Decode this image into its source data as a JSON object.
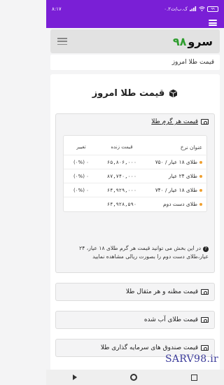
{
  "status_bar": {
    "time": "۸:۱۷",
    "network_info": "۰.۲ک.ب/ث",
    "battery": "۹۹"
  },
  "header": {
    "logo_text": "سرو",
    "logo_number": "۹۸"
  },
  "breadcrumb": {
    "text": "قیمت طلا امروز"
  },
  "page": {
    "title": "قیمت طلا امروز"
  },
  "gold_panel": {
    "title": "قیمت هر گرم طلا",
    "table": {
      "headers": {
        "name": "عنوان نرخ",
        "price": "قیمت زنده",
        "change": "تغییر"
      },
      "rows": [
        {
          "name": "طلای ۱۸ عیار / ۷۵۰",
          "price": "۶۵,۸۰۶,۰۰۰",
          "change": "۰ (۰%)"
        },
        {
          "name": "طلای ۲۴ عیار",
          "price": "۸۷,۷۴۰,۰۰۰",
          "change": "۰ (۰%)"
        },
        {
          "name": "طلای ۱۸ عیار / ۷۴۰",
          "price": "۶۴,۹۲۹,۰۰۰",
          "change": "۰ (۰%)"
        },
        {
          "name": "طلای دست دوم",
          "price": "۶۴,۹۲۸,۵۹۰",
          "change": ""
        }
      ]
    },
    "note": "در این بخش می توانید قیمت هر گرم طلای ۱۸ عیار، ۲۴ عیار،طلای دست دوم را بصورت ریالی مشاهده نمایید"
  },
  "panels": [
    {
      "title": "قیمت مظنه و هر مثقال طلا"
    },
    {
      "title": "قیمت طلای آب شده"
    },
    {
      "title": "قیمت صندوق های سرمایه گذاری طلا"
    }
  ],
  "watermark": "SARV98.ir"
}
